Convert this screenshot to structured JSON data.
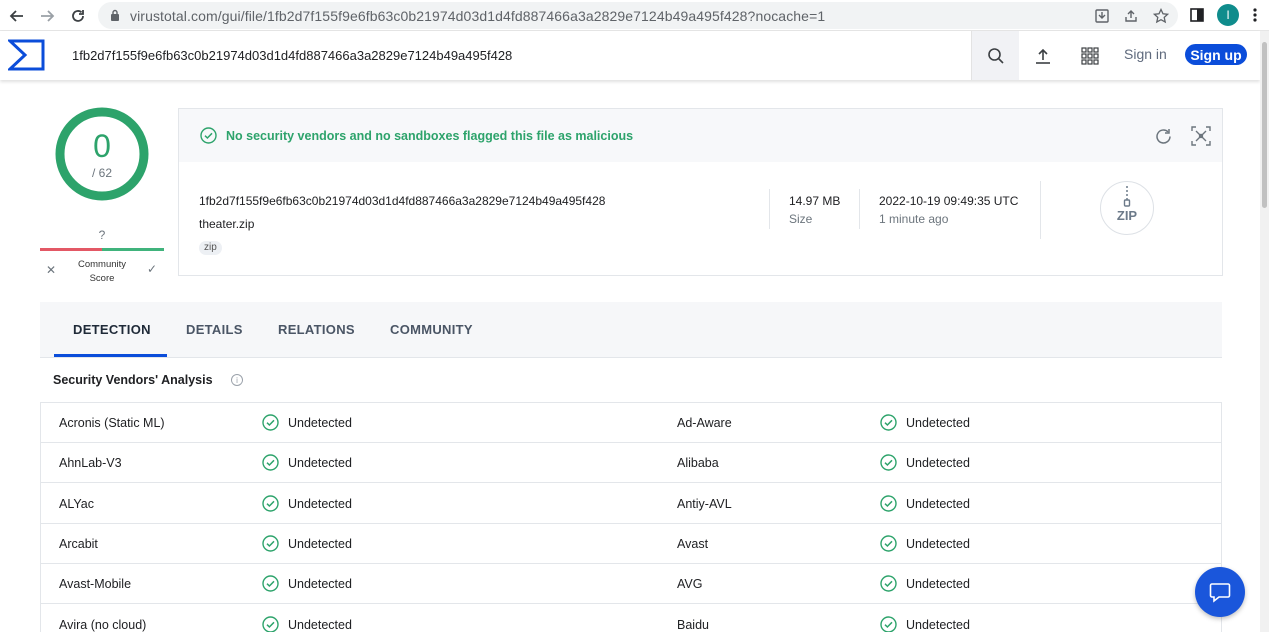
{
  "browser": {
    "url": "virustotal.com/gui/file/1fb2d7f155f9e6fb63c0b21974d03d1d4fd887466a3a2829e7124b49a495f428?nocache=1",
    "profile_initial": "I"
  },
  "header": {
    "search_value": "1fb2d7f155f9e6fb63c0b21974d03d1d4fd887466a3a2829e7124b49a495f428",
    "sign_in": "Sign in",
    "sign_up": "Sign up"
  },
  "score": {
    "detections": "0",
    "total": "/ 62",
    "community_question": "?",
    "community_label": "Community Score"
  },
  "summary": {
    "message": "No security vendors and no sandboxes flagged this file as malicious",
    "hash": "1fb2d7f155f9e6fb63c0b21974d03d1d4fd887466a3a2829e7124b49a495f428",
    "file_name": "theater.zip",
    "tag": "zip",
    "size_value": "14.97 MB",
    "size_label": "Size",
    "date_value": "2022-10-19 09:49:35 UTC",
    "date_relative": "1 minute ago",
    "file_type_icon": "ZIP"
  },
  "tabs": [
    {
      "label": "DETECTION",
      "active": true
    },
    {
      "label": "DETAILS",
      "active": false
    },
    {
      "label": "RELATIONS",
      "active": false
    },
    {
      "label": "COMMUNITY",
      "active": false
    }
  ],
  "analysis": {
    "title": "Security Vendors' Analysis",
    "rows": [
      {
        "left_vendor": "Acronis (Static ML)",
        "left_status": "Undetected",
        "right_vendor": "Ad-Aware",
        "right_status": "Undetected"
      },
      {
        "left_vendor": "AhnLab-V3",
        "left_status": "Undetected",
        "right_vendor": "Alibaba",
        "right_status": "Undetected"
      },
      {
        "left_vendor": "ALYac",
        "left_status": "Undetected",
        "right_vendor": "Antiy-AVL",
        "right_status": "Undetected"
      },
      {
        "left_vendor": "Arcabit",
        "left_status": "Undetected",
        "right_vendor": "Avast",
        "right_status": "Undetected"
      },
      {
        "left_vendor": "Avast-Mobile",
        "left_status": "Undetected",
        "right_vendor": "AVG",
        "right_status": "Undetected"
      },
      {
        "left_vendor": "Avira (no cloud)",
        "left_status": "Undetected",
        "right_vendor": "Baidu",
        "right_status": "Undetected"
      }
    ]
  },
  "colors": {
    "accent_blue": "#0b4dda",
    "clean_green": "#2da36b"
  }
}
